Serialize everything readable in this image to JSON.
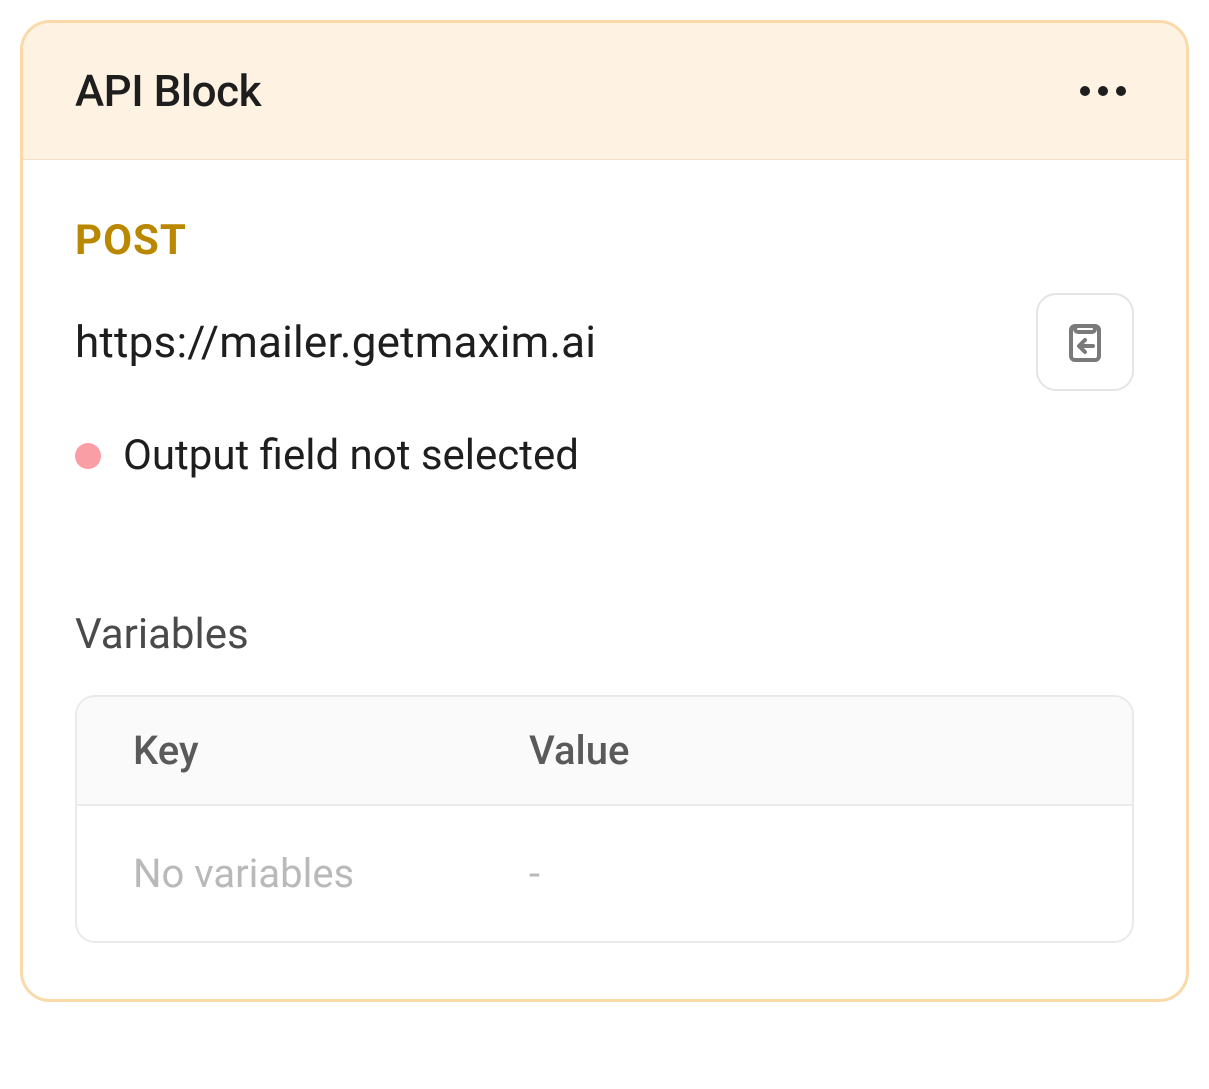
{
  "header": {
    "title": "API Block"
  },
  "request": {
    "method": "POST",
    "url": "https://mailer.getmaxim.ai"
  },
  "status": {
    "message": "Output field not selected",
    "dot_color": "#F99EA4"
  },
  "variables_section": {
    "label": "Variables",
    "columns": {
      "key": "Key",
      "value": "Value"
    },
    "empty_row": {
      "key": "No variables",
      "value": "-"
    }
  },
  "colors": {
    "border": "#FBD9A8",
    "header_bg": "#FEF2E3",
    "method": "#B98700"
  }
}
